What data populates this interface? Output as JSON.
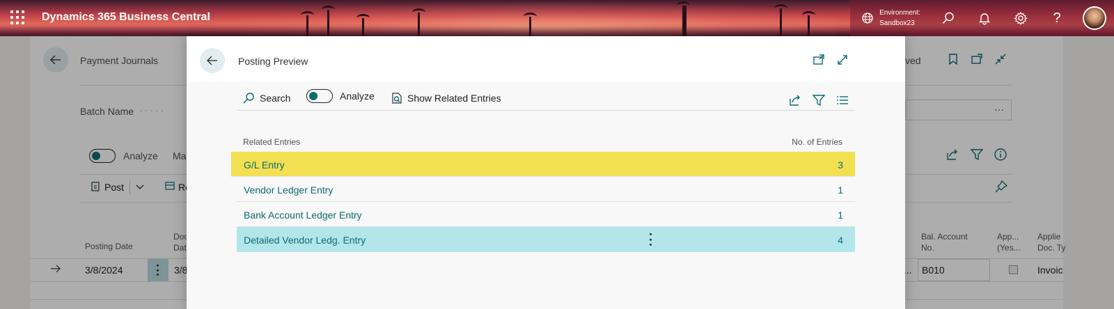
{
  "app": {
    "title": "Dynamics 365 Business Central",
    "environment_label": "Environment:",
    "environment_name": "Sandbox23"
  },
  "background_page": {
    "breadcrumb": "Payment Journals",
    "status_partial": "ved",
    "batch_label": "Batch Name",
    "batch_value_icon": "···",
    "analyze_label": "Analyze",
    "manage_partial": "Ma",
    "post_label": "Post",
    "reconcile_partial": "Re",
    "columns": {
      "posting_date": "Posting Date",
      "doc_date_partial1": "Doc",
      "doc_date_partial2": "Dat",
      "bal_account_no_1": "Bal. Account",
      "bal_account_no_2": "No.",
      "applies_yes_1": "App...",
      "applies_yes_2": "(Yes...",
      "applies_doc_1": "Applie",
      "applies_doc_2": "Doc. Ty"
    },
    "row": {
      "posting_date": "3/8/2024",
      "doc_date_partial": "3/8",
      "ellipsis": "...",
      "bal_account_no": "B010",
      "applies_doc_type": "Invoic"
    }
  },
  "modal": {
    "title": "Posting Preview",
    "actions": {
      "search": "Search",
      "analyze": "Analyze",
      "show_related": "Show Related Entries"
    },
    "grid": {
      "header_entries": "Related Entries",
      "header_count": "No. of Entries",
      "rows": [
        {
          "name": "G/L Entry",
          "count": "3"
        },
        {
          "name": "Vendor Ledger Entry",
          "count": "1"
        },
        {
          "name": "Bank Account Ledger Entry",
          "count": "1"
        },
        {
          "name": "Detailed Vendor Ledg. Entry",
          "count": "4"
        }
      ]
    }
  },
  "colors": {
    "accent_teal": "#0b6a75",
    "highlight_yellow": "#f2df52",
    "selected_row": "#b2e6ea"
  }
}
